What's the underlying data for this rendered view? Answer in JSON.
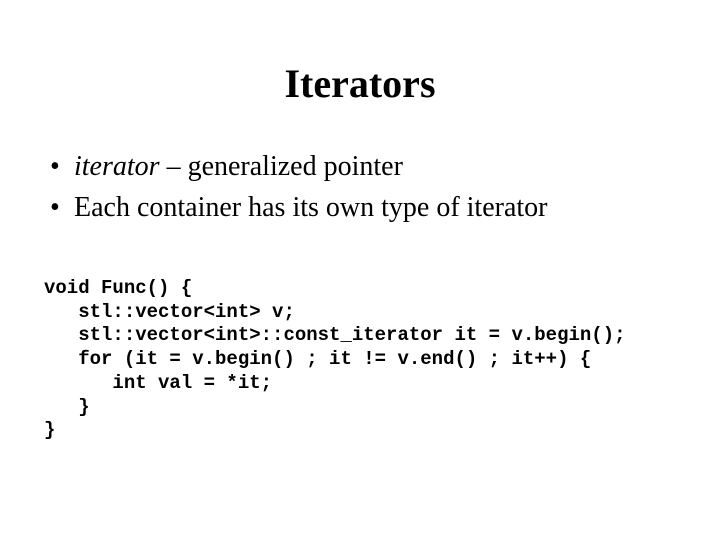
{
  "title": "Iterators",
  "bullets": {
    "b1_term": "iterator",
    "b1_rest": " – generalized pointer",
    "b2": "Each container has its own type of iterator"
  },
  "code": {
    "l1": "void Func() {",
    "l2": "   stl::vector<int> v;",
    "l3": "   stl::vector<int>::const_iterator it = v.begin();",
    "l4": "   for (it = v.begin() ; it != v.end() ; it++) {",
    "l5": "      int val = *it;",
    "l6": "   }",
    "l7": "}"
  }
}
